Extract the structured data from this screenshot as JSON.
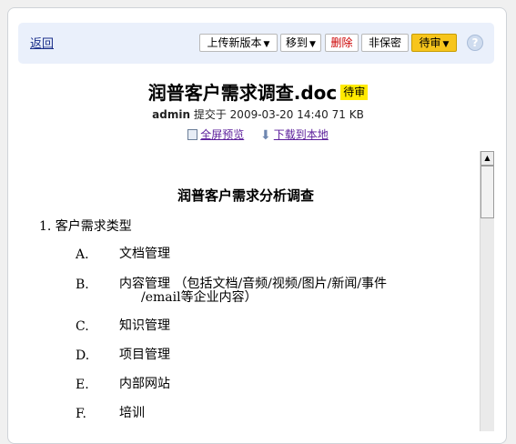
{
  "toolbar": {
    "back_label": "返回",
    "upload_label": "上传新版本",
    "move_label": "移到",
    "delete_label": "删除",
    "confidential_label": "非保密",
    "status_label": "待审",
    "help_symbol": "?"
  },
  "document": {
    "title": "润普客户需求调查.doc",
    "status_tag": "待审",
    "author": "admin",
    "submitted_text": "提交于 2009-03-20 14:40 71 KB",
    "preview_label": "全屏预览",
    "download_label": "下载到本地"
  },
  "content": {
    "heading": "润普客户需求分析调查",
    "section_label": "1.  客户需求类型",
    "items": [
      {
        "letter": "A.",
        "text": "文档管理"
      },
      {
        "letter": "B.",
        "text": "内容管理 （包括文档/音频/视频/图片/新闻/事件",
        "text2": "/email等企业内容）"
      },
      {
        "letter": "C.",
        "text": "知识管理"
      },
      {
        "letter": "D.",
        "text": "项目管理"
      },
      {
        "letter": "E.",
        "text": "内部网站"
      },
      {
        "letter": "F.",
        "text": "培训"
      }
    ]
  },
  "colors": {
    "toolbar_bg": "#eaf0fb",
    "status_yellow": "#f7c51c",
    "tag_yellow": "#ffea00",
    "delete_red": "#cc0000",
    "link_blue": "#1a2e8a",
    "link_purple": "#5a1c9a"
  },
  "icons": {
    "preview": "document-preview-icon",
    "download": "download-arrow-icon",
    "help": "help-icon"
  }
}
